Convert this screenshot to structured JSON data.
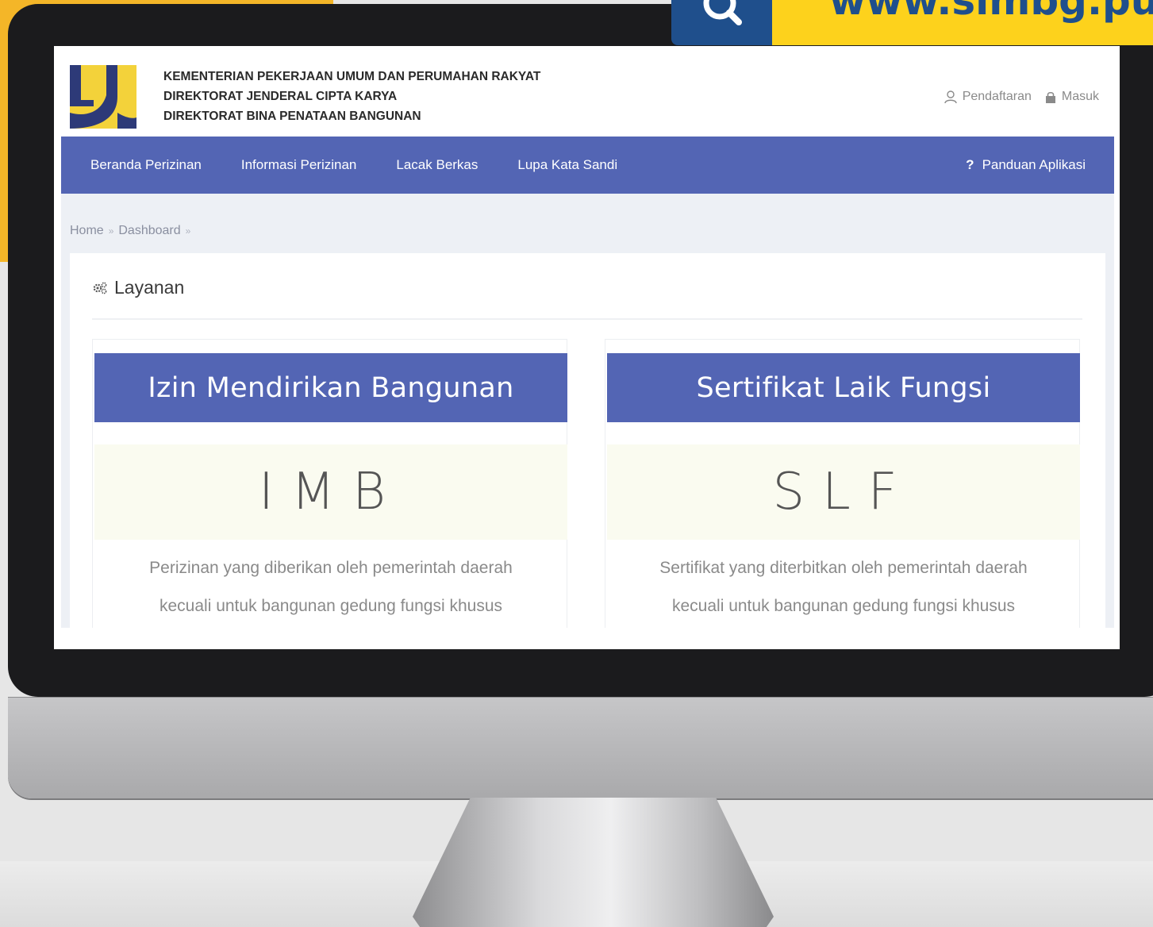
{
  "banner": {
    "search_icon": "search-icon",
    "url_text": "www.simbg.pu"
  },
  "header": {
    "org_lines": [
      "KEMENTERIAN PEKERJAAN UMUM DAN PERUMAHAN RAKYAT",
      "DIREKTORAT JENDERAL CIPTA KARYA",
      "DIREKTORAT BINA PENATAAN BANGUNAN"
    ],
    "register_label": "Pendaftaran",
    "login_label": "Masuk"
  },
  "nav": {
    "items": [
      {
        "label": "Beranda Perizinan"
      },
      {
        "label": "Informasi Perizinan"
      },
      {
        "label": "Lacak Berkas"
      },
      {
        "label": "Lupa Kata Sandi"
      }
    ],
    "help_icon": "?",
    "help_label": "Panduan Aplikasi"
  },
  "breadcrumb": {
    "items": [
      "Home",
      "Dashboard"
    ],
    "separator": "»"
  },
  "panel": {
    "title": "Layanan",
    "cards": [
      {
        "title": "Izin Mendirikan Bangunan",
        "abbr": "IMB",
        "desc_line1": "Perizinan yang diberikan oleh pemerintah daerah",
        "desc_line2": "kecuali untuk bangunan gedung fungsi khusus"
      },
      {
        "title": "Sertifikat Laik Fungsi",
        "abbr": "SLF",
        "desc_line1": "Sertifikat yang diterbitkan oleh pemerintah daerah",
        "desc_line2": "kecuali untuk bangunan gedung fungsi khusus"
      }
    ]
  },
  "colors": {
    "brand_blue": "#5365b4",
    "banner_yellow": "#fdd21c",
    "banner_blue": "#1f4f8c",
    "logo_yellow": "#f3d23a",
    "logo_navy": "#2d3a78"
  }
}
